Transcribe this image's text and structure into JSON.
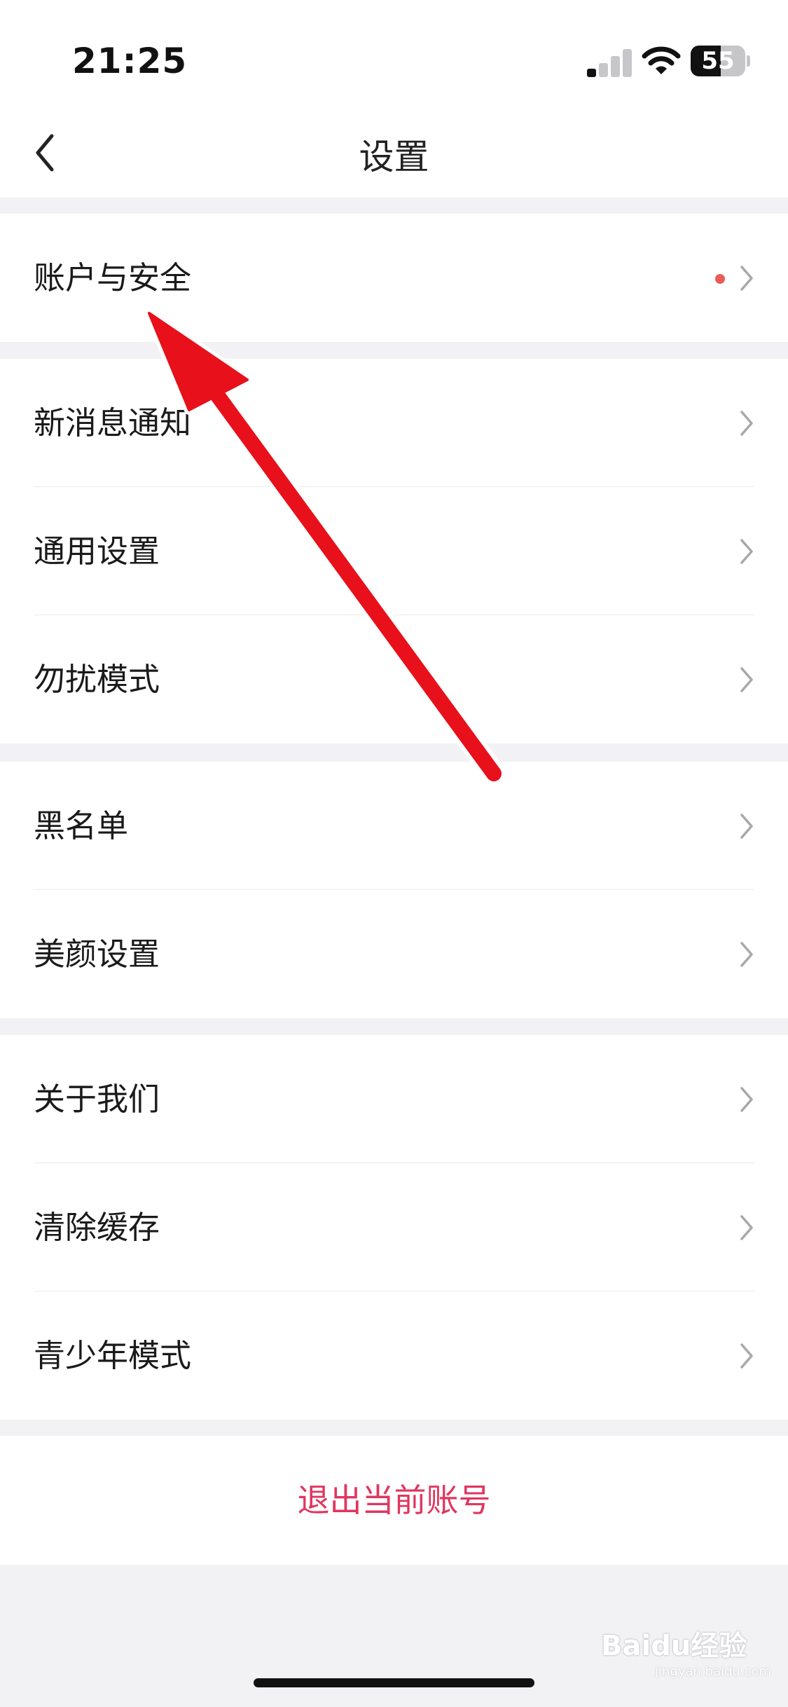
{
  "status_bar": {
    "time": "21:25",
    "battery": "55"
  },
  "header": {
    "title": "设置"
  },
  "sections": [
    {
      "items": [
        {
          "label": "账户与安全",
          "badge_color": "#ec5b56"
        }
      ]
    },
    {
      "items": [
        {
          "label": "新消息通知"
        },
        {
          "label": "通用设置"
        },
        {
          "label": "勿扰模式"
        }
      ]
    },
    {
      "items": [
        {
          "label": "黑名单"
        },
        {
          "label": "美颜设置"
        }
      ]
    },
    {
      "items": [
        {
          "label": "关于我们"
        },
        {
          "label": "清除缓存"
        },
        {
          "label": "青少年模式"
        }
      ]
    }
  ],
  "logout": {
    "label": "退出当前账号",
    "color": "#e0365f"
  },
  "watermark": {
    "text": "Baidu经验",
    "sub": "jingyan.baidu.com"
  },
  "annotation": {
    "arrow_color": "#e8101a"
  }
}
